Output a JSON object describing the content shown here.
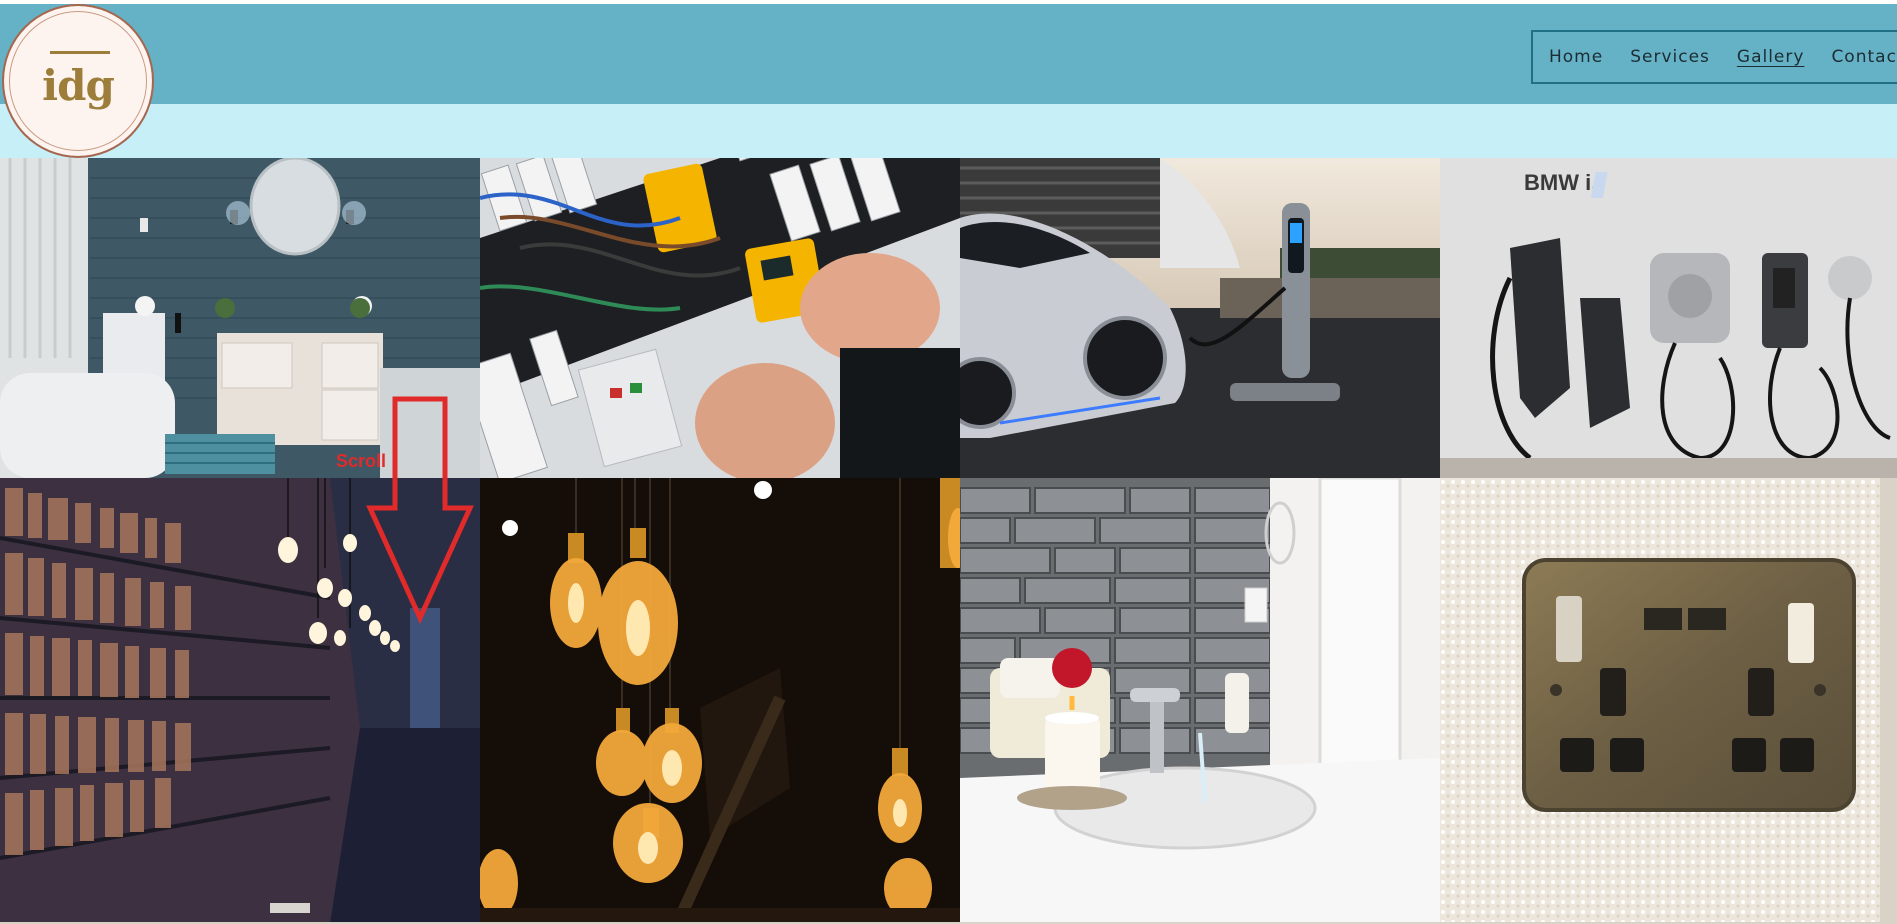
{
  "brand": {
    "logo_text": "idg"
  },
  "nav": {
    "items": [
      {
        "label": "Home",
        "active": false
      },
      {
        "label": "Services",
        "active": false
      },
      {
        "label": "Gallery",
        "active": true
      },
      {
        "label": "Contact",
        "active": false
      }
    ]
  },
  "annotation": {
    "scroll_label": "Scroll",
    "color": "#e12a2a"
  },
  "gallery": {
    "tiles": [
      {
        "subject": "bathroom-vanity"
      },
      {
        "subject": "electrical-panel-wiring"
      },
      {
        "subject": "ev-car-charging-station"
      },
      {
        "subject": "wall-mounted-ev-chargers"
      },
      {
        "subject": "library-bookshelves"
      },
      {
        "subject": "edison-light-bulbs"
      },
      {
        "subject": "bathroom-sink-candle"
      },
      {
        "subject": "double-wall-socket-usb"
      }
    ],
    "wall_label": "BMW i."
  },
  "colors": {
    "header": "#65b1c6",
    "subband": "#c6eff8",
    "nav_border": "#1f6f86",
    "logo_gold": "#9c7d3a"
  }
}
